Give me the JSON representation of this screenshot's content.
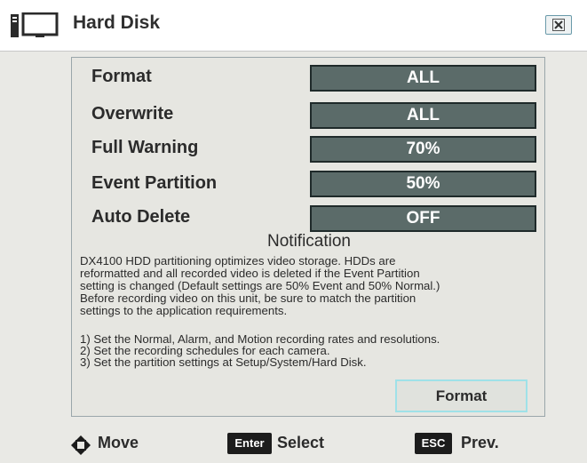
{
  "window": {
    "title": "Hard Disk",
    "title_icon": "computer-monitor-icon",
    "close_icon": "close-x-icon"
  },
  "settings": [
    {
      "label": "Format",
      "value": "ALL"
    },
    {
      "label": "Overwrite",
      "value": "ALL"
    },
    {
      "label": "Full Warning",
      "value": "70%"
    },
    {
      "label": "Event Partition",
      "value": "50%"
    },
    {
      "label": "Auto Delete",
      "value": "OFF"
    }
  ],
  "notification": {
    "title": "Notification",
    "body_lines": [
      "DX4100 HDD partitioning optimizes video storage. HDDs are",
      "reformatted and all recorded video is deleted if the Event Partition",
      "setting is changed (Default settings are 50% Event and 50% Normal.)",
      "Before recording video on this unit, be sure to match the partition",
      "settings to the application requirements."
    ],
    "steps": [
      "1)  Set the Normal, Alarm, and Motion recording rates and resolutions.",
      "2)  Set the recording schedules for each camera.",
      "3)  Set the partition settings at Setup/System/Hard Disk."
    ]
  },
  "format_button_label": "Format",
  "footer": {
    "move_label": "Move",
    "move_icon": "directional-pad-icon",
    "enter_key": "Enter",
    "select_label": "Select",
    "esc_key": "ESC",
    "prev_label": "Prev."
  },
  "colors": {
    "value_box": "#5b6b69",
    "focus_border": "#9fe1e8",
    "background": "#e9e9e5"
  }
}
